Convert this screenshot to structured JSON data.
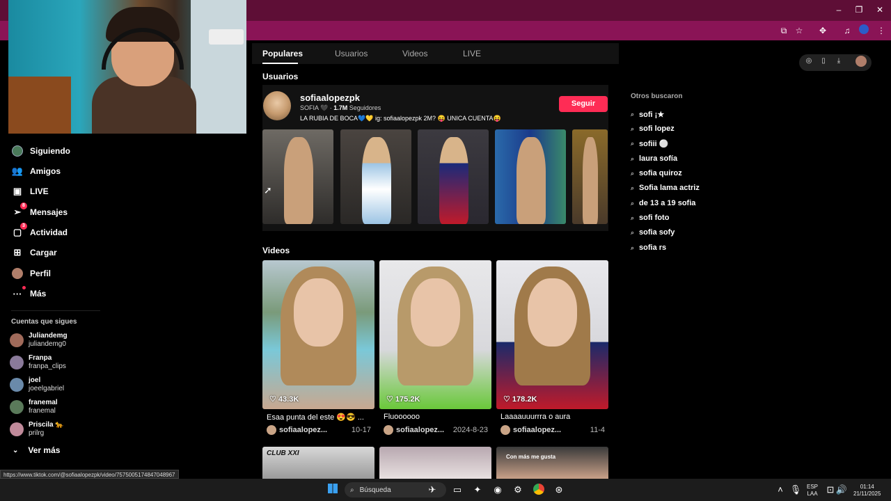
{
  "browser": {
    "window_controls": [
      "–",
      "❐",
      "✕"
    ],
    "toolbar_icons": [
      "cast-icon",
      "star-icon",
      "extensions-icon",
      "media-icon",
      "profile-icon",
      "menu-icon"
    ]
  },
  "sidebar": {
    "items": [
      {
        "label": "Siguiendo",
        "icon": "following-icon"
      },
      {
        "label": "Amigos",
        "icon": "friends-icon"
      },
      {
        "label": "LIVE",
        "icon": "live-icon"
      },
      {
        "label": "Mensajes",
        "icon": "messages-icon",
        "badge": "8"
      },
      {
        "label": "Actividad",
        "icon": "activity-icon",
        "badge": "3"
      },
      {
        "label": "Cargar",
        "icon": "upload-icon"
      },
      {
        "label": "Perfil",
        "icon": "profile-icon"
      },
      {
        "label": "Más",
        "icon": "more-icon"
      }
    ],
    "following_title": "Cuentas que sigues",
    "following": [
      {
        "name": "Juliandemg",
        "handle": "juliandemg0"
      },
      {
        "name": "Franpa",
        "handle": "franpa_clips"
      },
      {
        "name": "joel",
        "handle": "joeelgabriel"
      },
      {
        "name": "franemal",
        "handle": "franemal"
      },
      {
        "name": "Priscila 🐆",
        "handle": "prilrg"
      }
    ],
    "see_more": "Ver más"
  },
  "tabs": [
    "Populares",
    "Usuarios",
    "Videos",
    "LIVE"
  ],
  "users_section": {
    "title": "Usuarios",
    "user": {
      "username": "sofiaalopezpk",
      "nickname": "SOFIA 🖤",
      "followers": "1.7M",
      "followers_label": "Seguidores",
      "bio": "LA RUBIA DE BOCA💙💛 ig: sofiaalopezpk 2M? 😝 UNICA CUENTA😝",
      "follow_label": "Seguir"
    }
  },
  "videos_section": {
    "title": "Videos",
    "videos": [
      {
        "likes": "43.3K",
        "desc": "Esaa punta del este 😍😎 ...",
        "author": "sofiaalopez...",
        "date": "10-17"
      },
      {
        "likes": "175.2K",
        "desc": "Fluoooooo",
        "author": "sofiaalopez...",
        "date": "2024-8-23"
      },
      {
        "likes": "178.2K",
        "desc": "Laaaauuurrra o aura",
        "author": "sofiaalopez...",
        "date": "11-4"
      }
    ],
    "next_row_captions": [
      "CLUB XXI",
      "",
      "Con más me gusta"
    ]
  },
  "others": {
    "title": "Otros buscaron",
    "items": [
      "sofi ¡★",
      "sofi lopez",
      "sofiii ⚪",
      "laura sofía",
      "sofia quiroz",
      "Sofia lama actriz",
      "de 13 a 19 sofia",
      "sofi foto",
      "sofia sofy",
      "sofia rs"
    ]
  },
  "status_url": "https://www.tiktok.com/@sofiaalopezpk/video/7575005174847048967",
  "taskbar": {
    "search_placeholder": "Búsqueda",
    "lang_top": "ESP",
    "lang_bottom": "LAA",
    "time": "01:14",
    "date": "21/11/2025"
  },
  "colors": {
    "accent": "#fe2c55",
    "titlebar": "#5e0e36",
    "toolbar": "#8a1456"
  }
}
